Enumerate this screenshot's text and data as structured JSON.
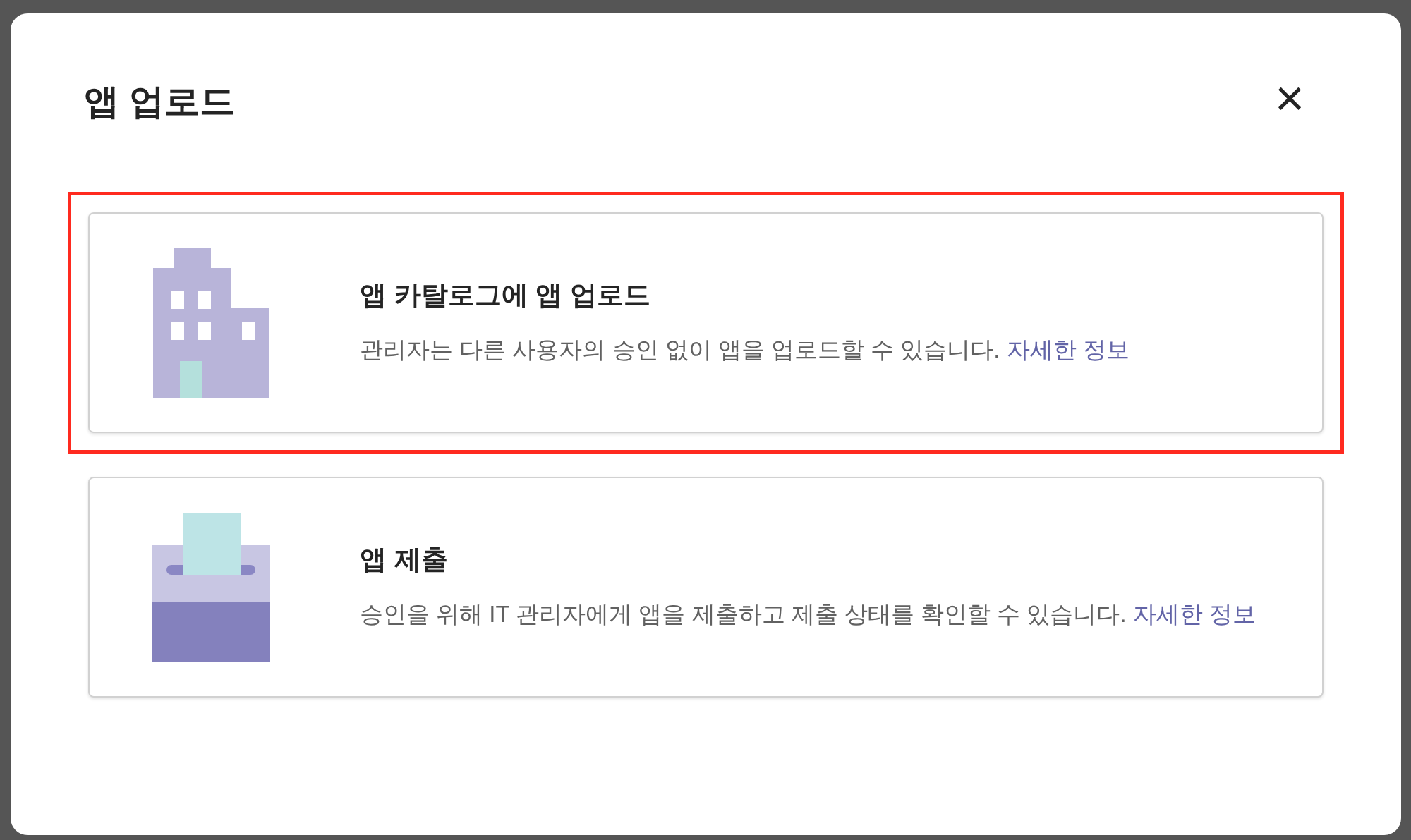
{
  "dialog": {
    "title": "앱 업로드",
    "close_label": "×"
  },
  "options": [
    {
      "kind": "building",
      "highlighted": true,
      "title": "앱 카탈로그에 앱 업로드",
      "description": "관리자는 다른 사용자의 승인 없이 앱을 업로드할 수 있습니다.",
      "link": "자세한 정보"
    },
    {
      "kind": "submit",
      "highlighted": false,
      "title": "앱 제출",
      "description": "승인을 위해 IT 관리자에게 앱을 제출하고 제출 상태를 확인할 수 있습니다.",
      "link": "자세한 정보"
    }
  ]
}
